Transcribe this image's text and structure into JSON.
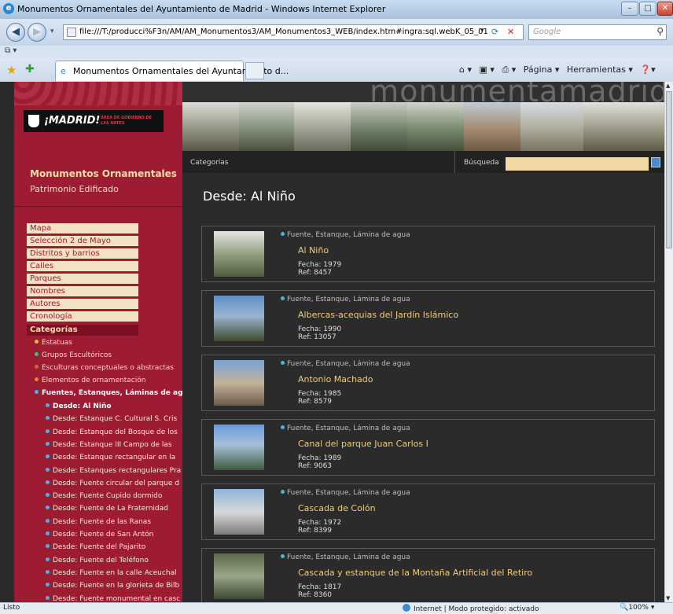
{
  "window": {
    "title": "Monumentos Ornamentales del Ayuntamiento de Madrid - Windows Internet Explorer",
    "minimize": "–",
    "maximize": "□",
    "close": "✕"
  },
  "navigation": {
    "back_icon": "◀",
    "forward_icon": "▶",
    "address": "file:///T:/producci%F3n/AM/AM_Monumentos3/AM_Monumentos3_WEB/index.htm#ingra:sql.webK_05_01",
    "search_placeholder": "Google"
  },
  "tabs": {
    "active_tab": "Monumentos Ornamentales del Ayuntamiento d...",
    "commands": [
      "Página ▾",
      "Herramientas ▾"
    ]
  },
  "sidebar": {
    "logo_text": "¡MADRID!",
    "logo_area": "ÁREA DE GOBIERNO DE LAS ARTES",
    "title": "Monumentos Ornamentales",
    "subtitle": "Patrimonio Edificado",
    "menu": [
      "Mapa",
      "Selección 2 de Mayo",
      "Distritos y barrios",
      "Calles",
      "Parques",
      "Nombres",
      "Autores",
      "Cronología",
      "Categorías"
    ],
    "categories": [
      {
        "label": "Estatuas",
        "dot": "#f0b23a"
      },
      {
        "label": "Grupos Escultóricos",
        "dot": "#3fc06a"
      },
      {
        "label": "Esculturas conceptuales o abstractas",
        "dot": "#e05a3a"
      },
      {
        "label": "Elementos de ornamentación",
        "dot": "#e08a2a"
      },
      {
        "label": "Fuentes, Estanques, Láminas de agua",
        "dot": "#4ab3e0"
      }
    ],
    "desde_items": [
      "Desde: Al Niño",
      "Desde: Estanque C. Cultural S. Cris",
      "Desde: Estanque del Bosque de los",
      "Desde: Estanque III Campo de las",
      "Desde: Estanque rectangular en la",
      "Desde: Estanques rectangulares Pra",
      "Desde: Fuente circular del parque d",
      "Desde: Fuente Cupido dormido",
      "Desde: Fuente de La Fraternidad",
      "Desde: Fuente de las Ranas",
      "Desde: Fuente de San Antón",
      "Desde: Fuente del Pajarito",
      "Desde: Fuente del Teléfono",
      "Desde: Fuente en la calle Aceuchal",
      "Desde: Fuente en la glorieta de Bilb",
      "Desde: Fuente monumental en casc"
    ]
  },
  "banner": {
    "title": "monumentamadrid"
  },
  "toolbar": {
    "tab_label": "Categorías",
    "search_label": "Búsqueda"
  },
  "main": {
    "heading": "Desde: Al Niño",
    "results": [
      {
        "category": "Fuente, Estanque, Lámina de agua",
        "title": "Al Niño",
        "date": "Fecha: 1979",
        "ref": "Ref: 8457"
      },
      {
        "category": "Fuente, Estanque, Lámina de agua",
        "title": "Albercas-acequias del Jardín Islámico",
        "date": "Fecha: 1990",
        "ref": "Ref: 13057"
      },
      {
        "category": "Fuente, Estanque, Lámina de agua",
        "title": "Antonio Machado",
        "date": "Fecha: 1985",
        "ref": "Ref: 8579"
      },
      {
        "category": "Fuente, Estanque, Lámina de agua",
        "title": "Canal del parque Juan Carlos I",
        "date": "Fecha: 1989",
        "ref": "Ref: 9063"
      },
      {
        "category": "Fuente, Estanque, Lámina de agua",
        "title": "Cascada de Colón",
        "date": "Fecha: 1972",
        "ref": "Ref: 8399"
      },
      {
        "category": "Fuente, Estanque, Lámina de agua",
        "title": "Cascada y estanque de la Montaña Artificial del Retiro",
        "date": "Fecha: 1817",
        "ref": "Ref: 8360"
      }
    ]
  },
  "status": {
    "text": "Listo",
    "zone": "Internet | Modo protegido: activado",
    "zoom": "100%"
  }
}
